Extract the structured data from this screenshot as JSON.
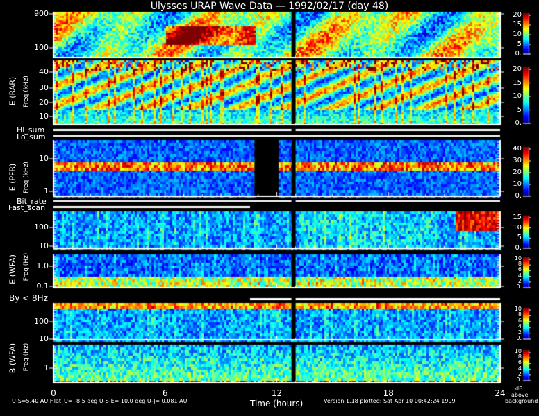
{
  "title": "Ulysses URAP Wave Data — 1992/02/17  (day 48)",
  "footer": {
    "left": "U-S=5.40 AU  Hlat_U= -8.5 deg  U-S-E= 10.0 deg  U-J= 0.081 AU",
    "right": "Version 1.18 plotted: Sat Apr 10 00:42:24 1999",
    "colorbar_unit": [
      "dB",
      "above",
      "background"
    ]
  },
  "chart_data": {
    "type": "heatmap",
    "title": "Ulysses URAP Wave Data — 1992/02/17  (day 48)",
    "xlabel": "Time (hours)",
    "xlim": [
      0,
      24
    ],
    "xticks": [
      "0",
      "6",
      "12",
      "18",
      "24"
    ],
    "colormap": "jet",
    "colorbar_label": "dB above background",
    "groups": [
      {
        "instrument": "E (RAR)",
        "ylabel": "Freq (kHz)",
        "panels": [
          {
            "yticks": [
              "900",
              "100"
            ],
            "scale": "log",
            "colorbar_ticks": [
              "20",
              "15",
              "10",
              "5",
              "0."
            ],
            "colorbar_range": [
              0,
              22
            ]
          },
          {
            "yticks": [
              "40",
              "30",
              "20",
              "10"
            ],
            "scale": "linear",
            "colorbar_ticks": [
              "20",
              "15",
              "10",
              "5",
              "0."
            ],
            "colorbar_range": [
              0,
              22
            ]
          }
        ]
      },
      {
        "status_lines": [
          "Hi_sum",
          "Lo_sum"
        ]
      },
      {
        "instrument": "E (PFR)",
        "ylabel": "Freq (kHz)",
        "panels": [
          {
            "yticks": [
              "10",
              "1"
            ],
            "scale": "log",
            "colorbar_ticks": [
              "40",
              "30",
              "20",
              "10",
              "0."
            ],
            "colorbar_range": [
              0,
              43
            ]
          }
        ]
      },
      {
        "status_lines": [
          "Bit_rate",
          "Fast_scan"
        ]
      },
      {
        "instrument": "E (WFA)",
        "ylabel": "Freq (Hz)",
        "panels": [
          {
            "yticks": [
              "100",
              "10"
            ],
            "scale": "log",
            "colorbar_ticks": [
              "15",
              "10",
              "5",
              "0."
            ],
            "colorbar_range": [
              0,
              16
            ]
          },
          {
            "yticks": [
              "1.0",
              "0.1"
            ],
            "scale": "log",
            "colorbar_ticks": [
              "10",
              "8",
              "6",
              "4",
              "2",
              "0."
            ],
            "colorbar_range": [
              0,
              10
            ]
          }
        ]
      },
      {
        "status_lines": [
          "By < 8Hz"
        ]
      },
      {
        "instrument": "B (WFA)",
        "ylabel": "Freq (Hz)",
        "panels": [
          {
            "yticks": [
              "100",
              "10"
            ],
            "scale": "log",
            "colorbar_ticks": [
              "10",
              "8",
              "6",
              "4",
              "2",
              "0."
            ],
            "colorbar_range": [
              0,
              10
            ]
          },
          {
            "yticks": [
              "1"
            ],
            "scale": "log",
            "colorbar_ticks": [
              "10",
              "8",
              "6",
              "4",
              "2",
              "0."
            ],
            "colorbar_range": [
              0,
              10
            ]
          }
        ]
      }
    ],
    "data_gap_hours": 12.9
  }
}
